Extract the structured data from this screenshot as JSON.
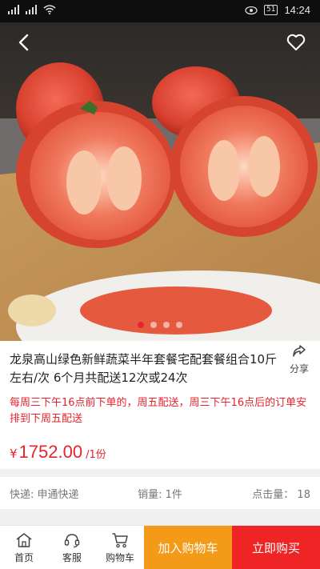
{
  "status_bar": {
    "battery": "51",
    "time": "14:24"
  },
  "product": {
    "title": "龙泉高山绿色新鲜蔬菜半年套餐宅配套餐组合10斤左右/次 6个月共配送12次或24次",
    "share_label": "分享",
    "notice": "每周三下午16点前下单的，周五配送，周三下午16点后的订单安排到下周五配送",
    "currency": "¥",
    "price": "1752.00",
    "unit": "/1份",
    "carousel": {
      "count": 4,
      "active_index": 0
    }
  },
  "meta": {
    "delivery": "快递: 申通快递",
    "sales": "销量: 1件",
    "clicks": "点击量： 18"
  },
  "bottom_bar": {
    "home": "首页",
    "service": "客服",
    "cart": "购物车",
    "add_to_cart": "加入购物车",
    "buy_now": "立即购买"
  },
  "colors": {
    "accent_red": "#e8232d",
    "add_cart_orange": "#f39a19",
    "buy_red": "#ef2424"
  }
}
